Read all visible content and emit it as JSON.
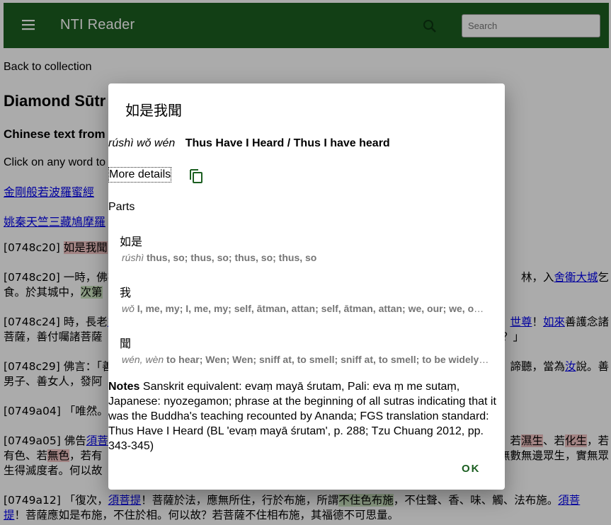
{
  "appbar": {
    "title": "NTI Reader",
    "search_placeholder": "Search"
  },
  "page": {
    "back_link": "Back to collection",
    "doc_title": "Diamond Sūtr",
    "sub_title": "Chinese text from",
    "hint": "Click on any word to",
    "link1": "金剛般若波羅蜜經",
    "link2": "姚秦天竺三藏鳩摩羅",
    "lines": {
      "l1_id": "[0748c20]",
      "l1_word": "如是我聞",
      "l1_rest": "：",
      "l2_id": "[0748c20]",
      "l2_a": "一時，佛在",
      "l2_b": "林，入",
      "l2_link": "舍衛大城",
      "l2_c": "乞",
      "l3_a": "食。於其城中，",
      "l3_hl": "次第",
      "l4_id": "[0748c24]",
      "l4_a": "時，長老",
      "l4_b": "須",
      "l4_link1": "世尊",
      "l4_c": "！",
      "l4_link2": "如來",
      "l4_d": "善護念諸",
      "l5_a": "菩薩，善付囑諸菩薩",
      "l5_b": "？」",
      "l6_id": "[0748c29]",
      "l6_a": "佛言：「善",
      "l6_b": "諦聽，當為",
      "l6_link": "汝",
      "l6_c": "說。善",
      "l7_a": "男子、善女人，發阿",
      "l8_id": "[0749a04]",
      "l8_a": "「唯然。",
      "l8_b": "世",
      "l9_id": "[0749a05]",
      "l9_a": "佛告",
      "l9_link": "須菩提",
      "l9_b": "若",
      "l9_hl1": "濕生",
      "l9_c": "、若",
      "l9_hl2": "化生",
      "l9_d": "，若",
      "l10_a": "有色、若",
      "l10_hl": "無色",
      "l10_b": "，若有",
      "l10_c": "，實無",
      "l10_d": "量無數無邊眾生，實無眾",
      "l11_a": "生得滅度者。何以故",
      "l12_id": "[0749a12]",
      "l12_a": "「復次，",
      "l12_link1": "須菩提",
      "l12_b": "！菩薩於法，應無所住，行於布施，所謂",
      "l12_hl": "不住色布施",
      "l12_c": "，不住聲、香、味、觸、法布施。",
      "l12_link2": "須菩",
      "l13_link": "提",
      "l13_a": "！菩薩應如是布施，不住於相。何以故？若菩薩不住相布施，其福德不可思量。"
    }
  },
  "dialog": {
    "title": "如是我聞",
    "pinyin": "rúshì wǒ wén",
    "english": "Thus Have I Heard / Thus I have heard",
    "more_details": "More details",
    "parts_label": "Parts",
    "parts": [
      {
        "chinese": "如是",
        "pinyin": "rúshì",
        "definition": "thus, so; thus, so; thus, so; thus, so"
      },
      {
        "chinese": "我",
        "pinyin": "wǒ",
        "definition": "I, me, my; I, me, my; self, ātman, attan; self, ātman, attan; we, our; we, our; [..."
      },
      {
        "chinese": "聞",
        "pinyin": "wén, wèn",
        "definition": "to hear; Wen; Wen; sniff at, to smell; sniff at, to smell; to be widely known..."
      }
    ],
    "notes_label": "Notes",
    "notes_text": "Sanskrit equivalent: evaṃ mayā śrutam, Pali: eva ṃ me sutaṃ, Japanese: nyozegamon; phrase at the beginning of all sutras indicating that it was the Buddha's teaching recounted by Ananda; FGS translation standard: Thus Have I Heard (BL 'evaṃ mayā śrutam', p. 288; Tzu Chuang 2012, pp. 343-345)",
    "ok_label": "OK"
  },
  "colors": {
    "appbar": "#1b5e20",
    "accent": "#1b5e20",
    "highlight_red": "#f2c4c4",
    "highlight_green": "#cfe8c4"
  },
  "icons": {
    "menu": "menu-icon",
    "search": "search-icon",
    "copy": "copy-icon"
  }
}
